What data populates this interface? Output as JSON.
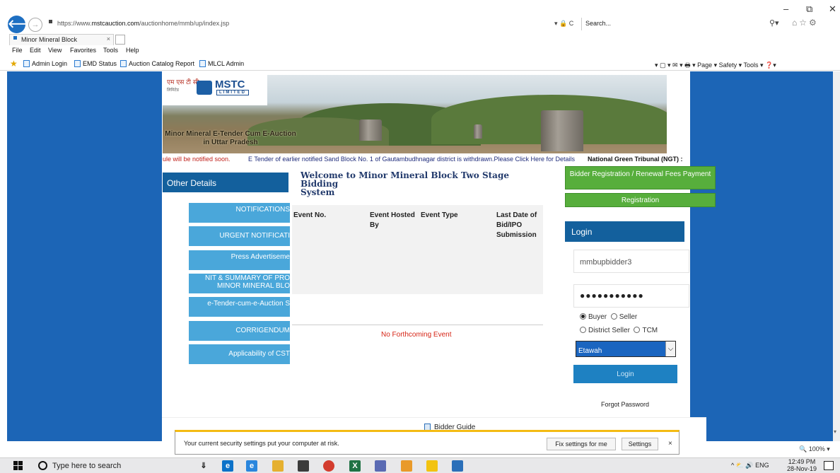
{
  "browser": {
    "url_prefix": "https://www.",
    "url_host": "mstcauction.com",
    "url_path": "/auctionhome/mmb/up/index.jsp",
    "addr_tools": "▾ 🔒 C",
    "search_placeholder": "Search...",
    "tab_title": "Minor Mineral Block",
    "tab_close": "×",
    "win_min": "–",
    "win_max": "⧉",
    "win_close": "✕",
    "menu": [
      "File",
      "Edit",
      "View",
      "Favorites",
      "Tools",
      "Help"
    ],
    "favorites": [
      "Admin Login",
      "EMD Status",
      "Auction Catalog Report",
      "MLCL Admin"
    ],
    "command_bar": "▾ ▢ ▾ ✉ ▾ 🖶 ▾ Page ▾ Safety ▾ Tools ▾ ❓▾"
  },
  "header": {
    "logo_hindi_line1": "एम एस टी सी",
    "logo_hindi_line2": "लिमिटेड",
    "logo_name": "MSTC",
    "logo_sub": "LIMITED",
    "banner_title_line1": "Minor Mineral E-Tender Cum E-Auction",
    "banner_title_line2": "in Uttar Pradesh"
  },
  "marquee": {
    "part1": "ule will be notified soon.",
    "part2": "E Tender of earlier notified Sand Block No. 1 of Gautambudhnagar district is withdrawn.Please Click Here for Details",
    "part3": "National Green Tribunal (NGT) :"
  },
  "left_menu": {
    "title": "Other Details",
    "items": [
      "NOTIFICATIONS",
      "URGENT NOTIFICATI",
      "Press Advertiseme",
      "NIT & SUMMARY OF PRO",
      "MINOR MINERAL BLO",
      "e-Tender-cum-e-Auction S",
      "CORRIGENDUM",
      "Applicability of CST"
    ]
  },
  "main": {
    "welcome_line1": "Welcome to Minor Mineral Block Two Stage Bidding",
    "welcome_line2": "System",
    "columns": [
      "Event No.",
      "Event Hosted By",
      "Event Type",
      "Last Date of Bid/IPO Submission"
    ],
    "empty_message": "No Forthcoming Event"
  },
  "right_panel": {
    "reg_fees_label": "Bidder Registration / Renewal Fees Payment",
    "registration_label": "Registration",
    "login_title": "Login",
    "username": "mmbupbidder3",
    "password_mask": "●●●●●●●●●●●",
    "roles": [
      "Buyer",
      "Seller",
      "District Seller",
      "TCM"
    ],
    "selected_role": "Buyer",
    "district": "Etawah",
    "login_button": "Login",
    "forgot_password": "Forgot Password"
  },
  "footer": {
    "bidder_guide": "Bidder Guide"
  },
  "notification_bar": {
    "message": "Your current security settings put your computer at risk.",
    "fix_button": "Fix settings for me",
    "settings_button": "Settings",
    "close": "×"
  },
  "zoom_level": "🔍 100% ▾",
  "taskbar": {
    "search_placeholder": "Type here to search",
    "tray": "^ ⛅ 🔊 ENG",
    "time": "12:49 PM",
    "date": "28-Nov-19"
  },
  "colors": {
    "page_background": "#1c65b6",
    "header_blue": "#13609d",
    "menu_light_blue": "#4aa7da",
    "green_button": "#57ae3c",
    "alert_red": "#d62516",
    "warning_yellow": "#f4bb13"
  }
}
